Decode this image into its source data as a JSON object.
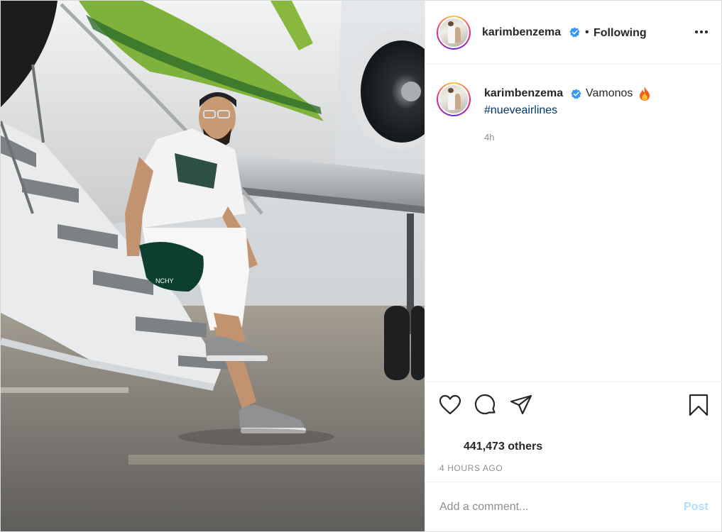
{
  "post": {
    "author": {
      "username": "karimbenzema",
      "verified": true,
      "avatar": "profile-photo"
    },
    "follow_status": "Following",
    "separator": "•",
    "caption": {
      "text": "Vamonos",
      "emoji_icon": "fire-icon",
      "hashtag": "#nueveairlines",
      "time_ago": "4h"
    },
    "likes_text": "441,473 others",
    "timestamp": "4 HOURS AGO",
    "comment_input": {
      "placeholder": "Add a comment...",
      "value": ""
    },
    "post_button": "Post",
    "icons": {
      "more": "more-options-icon",
      "like": "heart-icon",
      "comment": "comment-icon",
      "share": "paper-plane-icon",
      "save": "bookmark-icon",
      "verified": "verified-badge-icon"
    },
    "colors": {
      "link": "#00376b",
      "verified": "#3897f0",
      "muted": "#8e8e8e",
      "post_button_disabled": "#b3dbff"
    }
  }
}
